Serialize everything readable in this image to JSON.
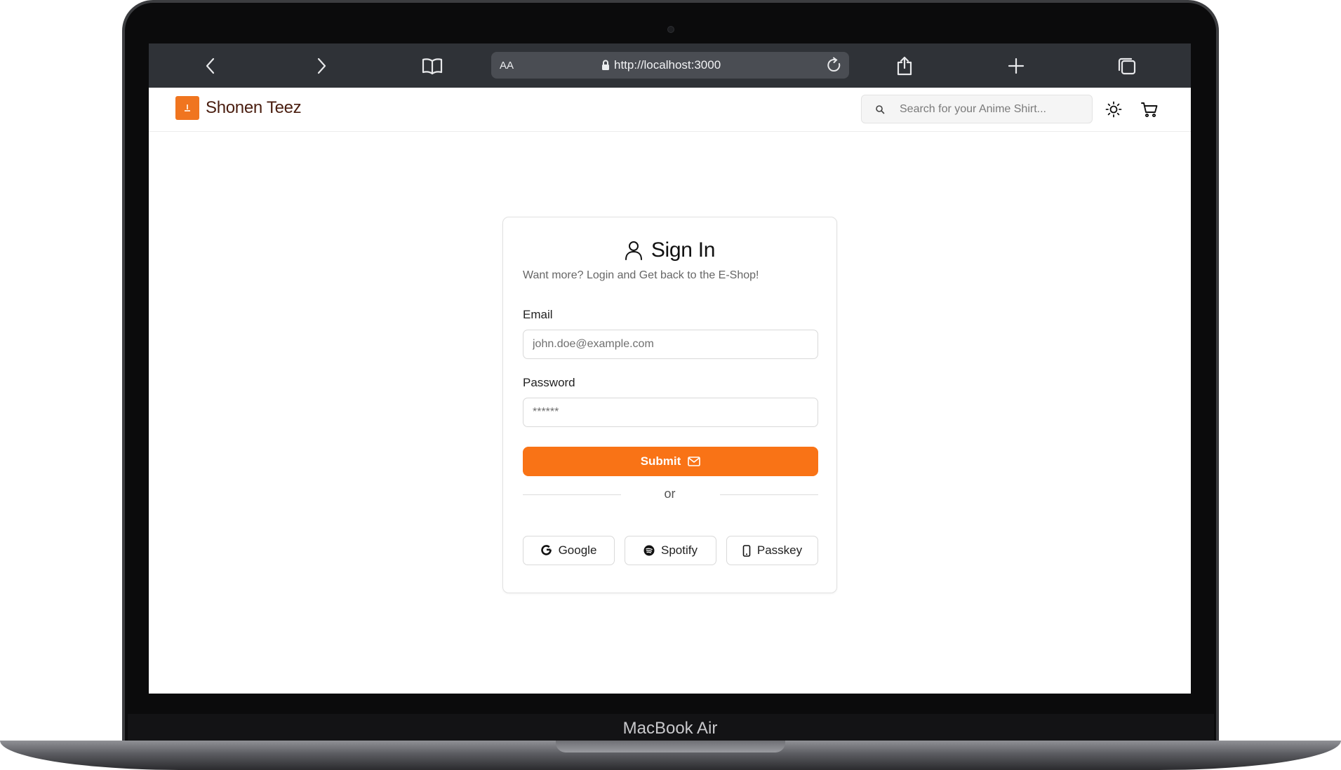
{
  "device": {
    "label": "MacBook Air"
  },
  "browser": {
    "text_size_label": "AA",
    "url": "http://localhost:3000",
    "icons": [
      "back-icon",
      "forward-icon",
      "bookmarks-icon",
      "lock-icon",
      "reload-icon",
      "share-icon",
      "new-tab-icon",
      "tabs-icon"
    ]
  },
  "header": {
    "brand": "Shonen Teez",
    "search_placeholder": "Search for your Anime Shirt...",
    "icons": [
      "search-icon",
      "sun-icon",
      "cart-icon"
    ]
  },
  "signin": {
    "title": "Sign In",
    "subtitle": "Want more? Login and Get back to the E-Shop!",
    "email_label": "Email",
    "email_placeholder": "john.doe@example.com",
    "password_label": "Password",
    "password_placeholder": "******",
    "submit_label": "Submit",
    "divider_text": "or",
    "social": [
      {
        "label": "Google",
        "icon": "google-icon"
      },
      {
        "label": "Spotify",
        "icon": "spotify-icon"
      },
      {
        "label": "Passkey",
        "icon": "phone-icon"
      }
    ]
  },
  "colors": {
    "accent": "#f97316",
    "brand_text": "#4a1e10",
    "browser_toolbar": "#2f3237"
  }
}
